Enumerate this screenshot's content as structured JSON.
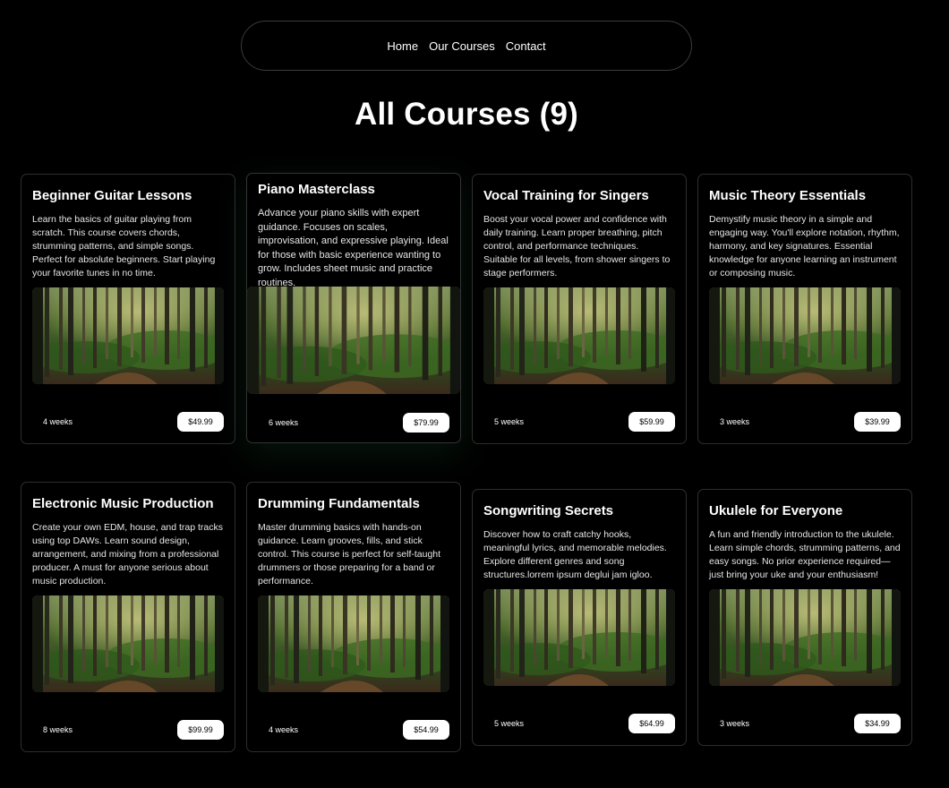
{
  "nav": {
    "items": [
      {
        "label": "Home"
      },
      {
        "label": "Our Courses"
      },
      {
        "label": "Contact"
      }
    ]
  },
  "page": {
    "title": "All Courses (9)"
  },
  "courses": [
    {
      "title": "Beginner Guitar Lessons",
      "description": "Learn the basics of guitar playing from scratch. This course covers chords, strumming patterns, and simple songs. Perfect for absolute beginners. Start playing your favorite tunes in no time.",
      "duration": "4 weeks",
      "price": "$49.99"
    },
    {
      "title": "Piano Masterclass",
      "description": "Advance your piano skills with expert guidance. Focuses on scales, improvisation, and expressive playing. Ideal for those with basic experience wanting to grow. Includes sheet music and practice routines.",
      "duration": "6 weeks",
      "price": "$79.99"
    },
    {
      "title": "Vocal Training for Singers",
      "description": "Boost your vocal power and confidence with daily training. Learn proper breathing, pitch control, and performance techniques. Suitable for all levels, from shower singers to stage performers.",
      "duration": "5 weeks",
      "price": "$59.99"
    },
    {
      "title": "Music Theory Essentials",
      "description": "Demystify music theory in a simple and engaging way. You'll explore notation, rhythm, harmony, and key signatures. Essential knowledge for anyone learning an instrument or composing music.",
      "duration": "3 weeks",
      "price": "$39.99"
    },
    {
      "title": "Electronic Music Production",
      "description": "Create your own EDM, house, and trap tracks using top DAWs. Learn sound design, arrangement, and mixing from a professional producer. A must for anyone serious about music production.",
      "duration": "8 weeks",
      "price": "$99.99"
    },
    {
      "title": "Drumming Fundamentals",
      "description": "Master drumming basics with hands-on guidance. Learn grooves, fills, and stick control. This course is perfect for self-taught drummers or those preparing for a band or performance.",
      "duration": "4 weeks",
      "price": "$54.99"
    },
    {
      "title": "Songwriting Secrets",
      "description": "Discover how to craft catchy hooks, meaningful lyrics, and memorable melodies. Explore different genres and song structures.lorrem ipsum deglui jam igloo.",
      "duration": "5 weeks",
      "price": "$64.99"
    },
    {
      "title": "Ukulele for Everyone",
      "description": "A fun and friendly introduction to the ukulele. Learn simple chords, strumming patterns, and easy songs. No prior experience required—just bring your uke and your enthusiasm!",
      "duration": "3 weeks",
      "price": "$34.99"
    }
  ],
  "icons": {
    "course_image": "forest-photo"
  }
}
